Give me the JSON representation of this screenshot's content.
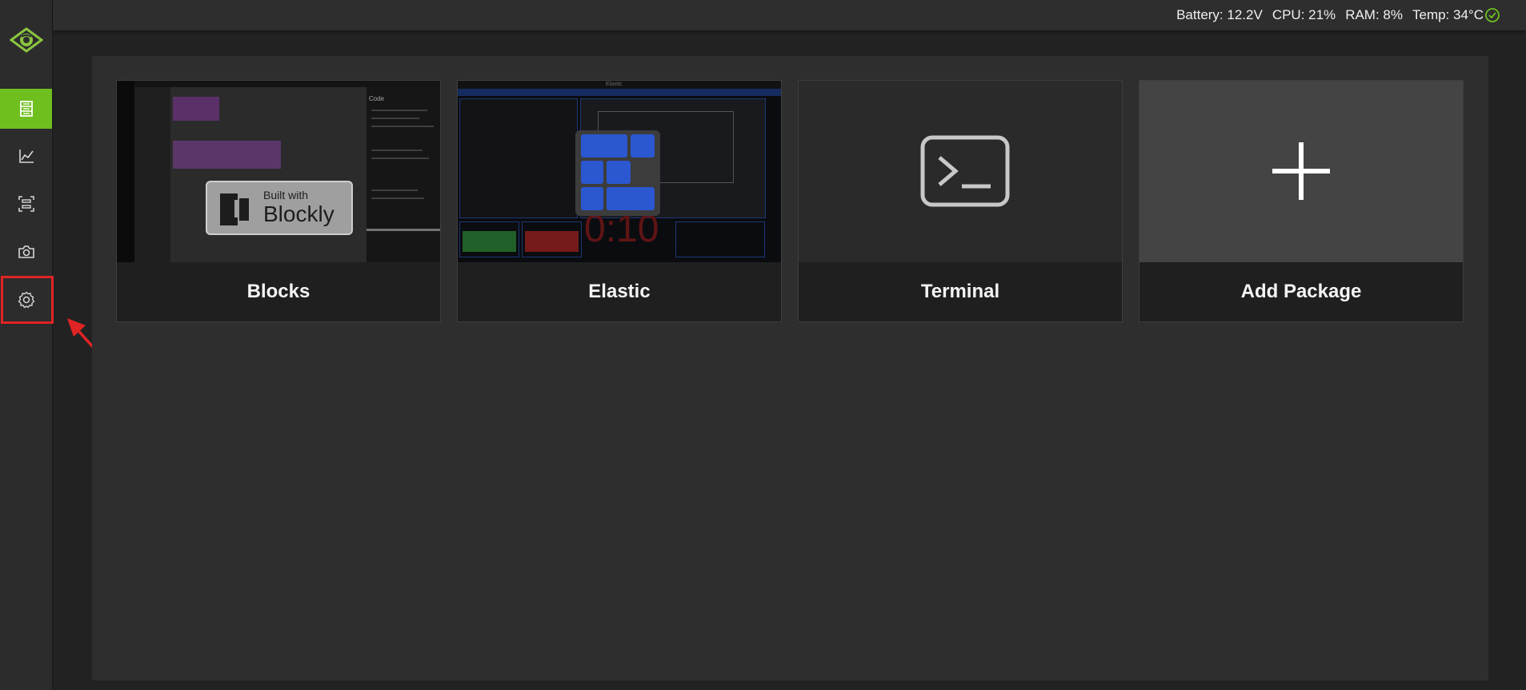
{
  "app": {
    "accent_color": "#6fbf1f",
    "highlight_color": "#e02424"
  },
  "sidebar": {
    "logo": "eye-logo-icon",
    "items": [
      {
        "icon": "packages-icon",
        "active": true
      },
      {
        "icon": "chart-icon",
        "active": false
      },
      {
        "icon": "scan-icon",
        "active": false
      },
      {
        "icon": "camera-icon",
        "active": false
      },
      {
        "icon": "gear-icon",
        "active": false
      }
    ]
  },
  "status_bar": {
    "battery": "Battery: 12.2V",
    "cpu": "CPU: 21%",
    "ram": "RAM: 8%",
    "temp": "Temp: 34°C",
    "status_icon": "check-circle-icon"
  },
  "packages": [
    {
      "name": "Blocks",
      "thumbnail": {
        "code_tab": "Code",
        "badge_line1": "Built with",
        "badge_line2": "Blockly"
      }
    },
    {
      "name": "Elastic",
      "thumbnail": {
        "window_title": "Elastic",
        "timer": "0:10"
      }
    },
    {
      "name": "Terminal",
      "thumbnail": {
        "icon": "terminal-icon"
      }
    },
    {
      "name": "Add Package",
      "thumbnail": {
        "icon": "plus-icon"
      }
    }
  ]
}
